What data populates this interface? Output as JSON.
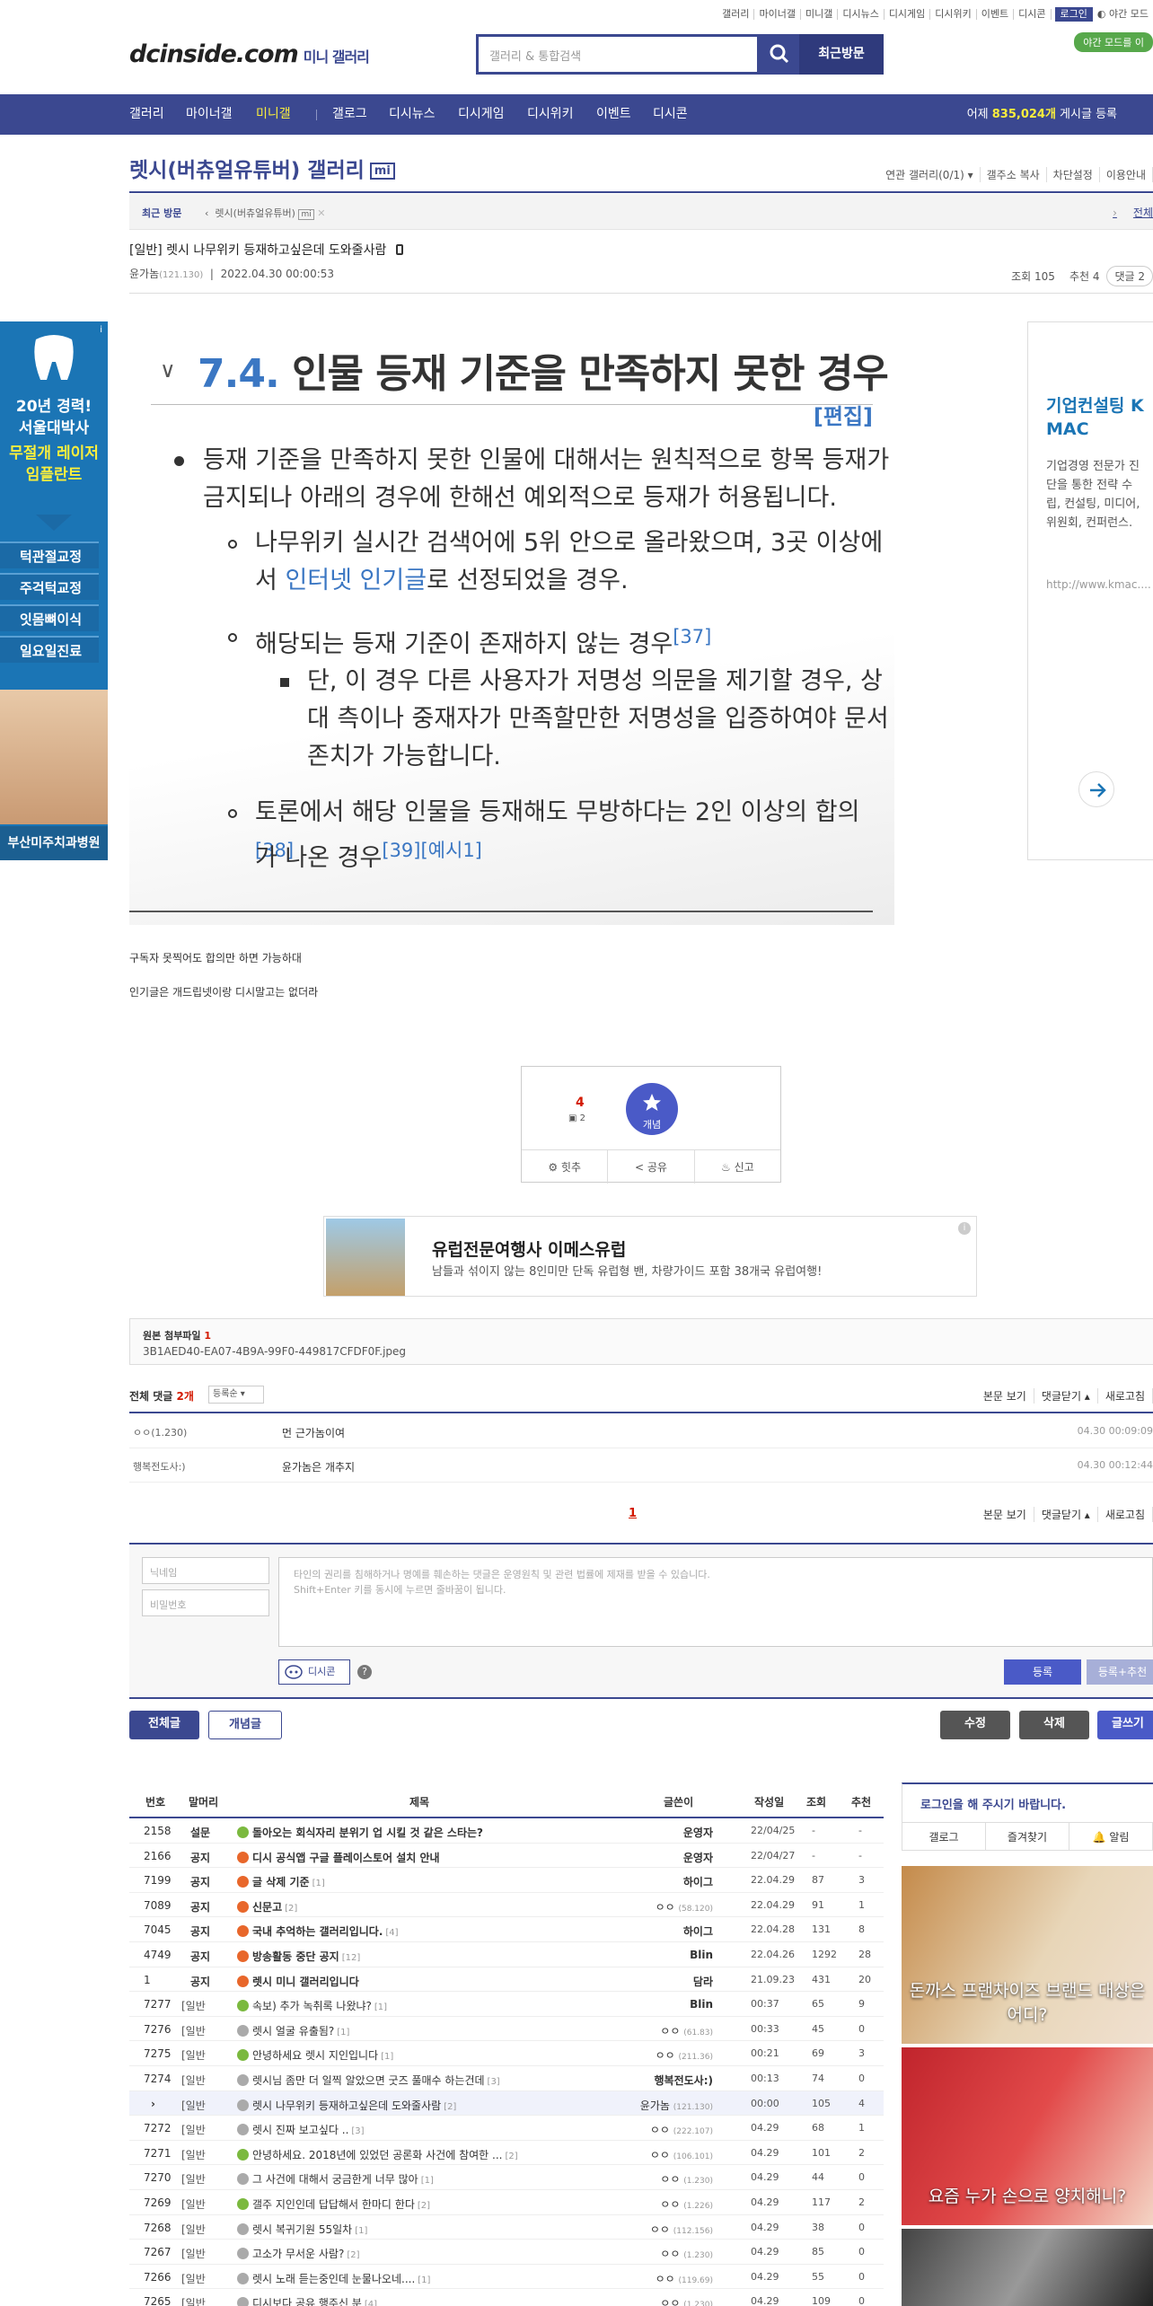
{
  "top_util": {
    "links": [
      "갤러리",
      "마이너갤",
      "미니갤",
      "디시뉴스",
      "디시게임",
      "디시위키",
      "이벤트",
      "디시콘"
    ],
    "login": "로그인",
    "night": "야간 모드",
    "night_badge": "야간 모드를 이"
  },
  "logo": {
    "brand": "dcinside.com",
    "sub": "미니 갤러리"
  },
  "search": {
    "placeholder": "갤러리 & 통합검색",
    "recent": "최근방문"
  },
  "nav": {
    "items": [
      "갤러리",
      "마이너갤",
      "미니갤",
      "갤로그",
      "디시뉴스",
      "디시게임",
      "디시위키",
      "이벤트",
      "디시콘"
    ],
    "visit_prefix": "어제 ",
    "visit_count": "835,024개",
    "visit_suffix": " 게시글 등록"
  },
  "gallery": {
    "title": "렛시(버츄얼유튜버) 갤러리",
    "badge": "mi",
    "menu": [
      "연관 갤러리(0/1) ▾",
      "갤주소 복사",
      "차단설정",
      "이용안내"
    ]
  },
  "recent_bar": {
    "label": "최근 방문",
    "item": "렛시(버츄얼유튜버)",
    "badge": "mi",
    "all": "전체"
  },
  "post": {
    "title": "[일반] 렛시 나무위키 등재하고싶은데 도와줄사람",
    "author": "윤가놈",
    "ip": "(121.130)",
    "date": "2022.04.30 00:00:53",
    "views": "조회 105",
    "recs": "추천 4",
    "comments": "댓글 2"
  },
  "wiki": {
    "num": "7.4.",
    "heading": "인물 등재 기준을 만족하지 못한 경우",
    "edit": "[편집]",
    "b1_l1": "등재 기준을 만족하지 못한 인물에 대해서는 원칙적으로 항목 등재가",
    "b1_l2": "금지되나 아래의 경우에 한해선 예외적으로 등재가 허용됩니다.",
    "b2_l1": "나무위키 실시간 검색어에 5위 안으로 올라왔으며, 3곳 이상에",
    "b2_pre": "서 ",
    "b2_link": "인터넷 인기글",
    "b2_post": "로 선정되었을 경우.",
    "b3": "해당되는 등재 기준이 존재하지 않는 경우",
    "b3_sup": "[37]",
    "b4_l1": "단, 이 경우 다른 사용자가 저명성 의문을 제기할 경우, 상",
    "b4_l2": "대 측이나 중재자가 만족할만한 저명성을 입증하여야 문서",
    "b4_l3": "존치가 가능합니다.",
    "b5_l1": "토론에서 해당 인물을 등재해도 무방하다는 2인 이상의 합의",
    "b5_sup1": "[38]",
    "b5_l2": "가 나온 경우",
    "b5_sup2": "[39]",
    "b5_sup3": "[예시1]"
  },
  "body": {
    "line1": "구독자 못찍어도 합의만 하면 가능하대",
    "line2": "인기글은 개드립넷이랑 디시말고는 없더라"
  },
  "recommend": {
    "count": "4",
    "sub": "2",
    "concept": "개념",
    "actions": [
      "힛추",
      "공유",
      "신고"
    ]
  },
  "banner": {
    "title": "유럽전문여행사 이메스유럽",
    "desc": "남들과 섞이지 않는 8인미만 단독 유럽형 밴, 차량가이드 포함 38개국 유럽여행!",
    "info": "i"
  },
  "attachment": {
    "label": "원본 첨부파일",
    "count": "1",
    "file": "3B1AED40-EA07-4B9A-99F0-449817CFDF0F.jpeg"
  },
  "comments": {
    "label": "전체 댓글",
    "count": "2개",
    "sort": "등록순 ▾",
    "options": [
      "본문 보기",
      "댓글닫기 ▴",
      "새로고침"
    ],
    "items": [
      {
        "nick": "ㅇㅇ(1.230)",
        "text": "먼 근가놈이여",
        "date": "04.30 00:09:09"
      },
      {
        "nick": "행복전도사:)",
        "text": "윤가놈은 개추지",
        "date": "04.30 00:12:44"
      }
    ],
    "page": "1"
  },
  "write": {
    "nick": "닉네임",
    "pw": "비밀번호",
    "ta1": "타인의 권리를 침해하거나 명예를 훼손하는 댓글은 운영원칙 및 관련 법률에 제재를 받을 수 있습니다.",
    "ta2": "Shift+Enter 키를 동시에 누르면 줄바꿈이 됩니다.",
    "dccon": "디시콘",
    "help": "?",
    "submit": "등록",
    "submit_rec": "등록+추천"
  },
  "buttons": {
    "all": "전체글",
    "concept": "개념글",
    "edit": "수정",
    "delete": "삭제",
    "write": "글쓰기"
  },
  "table": {
    "headers": [
      "번호",
      "말머리",
      "제목",
      "글쓴이",
      "작성일",
      "조회",
      "추천"
    ],
    "rows": [
      {
        "no": "2158",
        "head": "설문",
        "title": "돌아오는 회식자리 분위기 업 시킬 것 같은 스타는?",
        "cnt": "",
        "writer": "운영자",
        "ip": "",
        "date": "22/04/25",
        "view": "-",
        "rec": "-",
        "icon": "#7bb93f",
        "bold": true
      },
      {
        "no": "2166",
        "head": "공지",
        "title": "디시 공식앱 구글 플레이스토어 설치 안내",
        "cnt": "",
        "writer": "운영자",
        "ip": "",
        "date": "22/04/27",
        "view": "-",
        "rec": "-",
        "icon": "#e8672b",
        "bold": true
      },
      {
        "no": "7199",
        "head": "공지",
        "title": "글 삭제 기준",
        "cnt": "[1]",
        "writer": "하이그",
        "ip": "",
        "date": "22.04.29",
        "view": "87",
        "rec": "3",
        "icon": "#e8672b",
        "bold": true
      },
      {
        "no": "7089",
        "head": "공지",
        "title": "신문고",
        "cnt": "[2]",
        "writer": "ㅇㅇ",
        "ip": "(58.120)",
        "date": "22.04.29",
        "view": "91",
        "rec": "1",
        "icon": "#e8672b",
        "bold": true
      },
      {
        "no": "7045",
        "head": "공지",
        "title": "국내 추억하는 갤러리입니다.",
        "cnt": "[4]",
        "writer": "하이그",
        "ip": "",
        "date": "22.04.28",
        "view": "131",
        "rec": "8",
        "icon": "#e8672b",
        "bold": true
      },
      {
        "no": "4749",
        "head": "공지",
        "title": "방송활동 중단 공지",
        "cnt": "[12]",
        "writer": "Blin",
        "ip": "",
        "date": "22.04.26",
        "view": "1292",
        "rec": "28",
        "icon": "#e8672b",
        "bold": true
      },
      {
        "no": "1",
        "head": "공지",
        "title": "렛시 미니 갤러리입니다",
        "cnt": "",
        "writer": "담라",
        "ip": "",
        "date": "21.09.23",
        "view": "431",
        "rec": "20",
        "icon": "#e8672b",
        "bold": true
      },
      {
        "no": "7277",
        "head": "[일반",
        "title": "속보) 추가 녹취록 나왔냐?",
        "cnt": "[1]",
        "writer": "Blin",
        "ip": "",
        "date": "00:37",
        "view": "65",
        "rec": "9",
        "icon": "#7bb93f",
        "bold": false
      },
      {
        "no": "7276",
        "head": "[일반",
        "title": "렛시 얼굴 유출됨?",
        "cnt": "[1]",
        "writer": "ㅇㅇ",
        "ip": "(61.83)",
        "date": "00:33",
        "view": "45",
        "rec": "0",
        "icon": "#aaa",
        "bold": false
      },
      {
        "no": "7275",
        "head": "[일반",
        "title": "안녕하세요 렛시 지인입니다",
        "cnt": "[1]",
        "writer": "ㅇㅇ",
        "ip": "(211.36)",
        "date": "00:21",
        "view": "69",
        "rec": "3",
        "icon": "#7bb93f",
        "bold": false
      },
      {
        "no": "7274",
        "head": "[일반",
        "title": "렛시님 좀만 더 일찍 알았으면 굿즈 풀매수 하는건데",
        "cnt": "[3]",
        "writer": "행복전도사:)",
        "ip": "",
        "date": "00:13",
        "view": "74",
        "rec": "0",
        "icon": "#aaa",
        "bold": false
      },
      {
        "no": "›",
        "head": "[일반",
        "title": "렛시 나무위키 등재하고싶은데 도와줄사람",
        "cnt": "[2]",
        "writer": "윤가놈",
        "ip": "(121.130)",
        "date": "00:00",
        "view": "105",
        "rec": "4",
        "icon": "#aaa",
        "bold": false,
        "current": true
      },
      {
        "no": "7272",
        "head": "[일반",
        "title": "렛시 진짜 보고싶다 ..",
        "cnt": "[3]",
        "writer": "ㅇㅇ",
        "ip": "(222.107)",
        "date": "04.29",
        "view": "68",
        "rec": "1",
        "icon": "#aaa",
        "bold": false
      },
      {
        "no": "7271",
        "head": "[일반",
        "title": "안녕하세요. 2018년에 있었던 공론화 사건에 참여한 ...",
        "cnt": "[2]",
        "writer": "ㅇㅇ",
        "ip": "(106.101)",
        "date": "04.29",
        "view": "101",
        "rec": "2",
        "icon": "#7bb93f",
        "bold": false
      },
      {
        "no": "7270",
        "head": "[일반",
        "title": "그 사건에 대해서 궁금한게 너무 많아",
        "cnt": "[1]",
        "writer": "ㅇㅇ",
        "ip": "(1.230)",
        "date": "04.29",
        "view": "44",
        "rec": "0",
        "icon": "#aaa",
        "bold": false
      },
      {
        "no": "7269",
        "head": "[일반",
        "title": "갤주 지인인데 답답해서 한마디 한다",
        "cnt": "[2]",
        "writer": "ㅇㅇ",
        "ip": "(1.226)",
        "date": "04.29",
        "view": "117",
        "rec": "2",
        "icon": "#7bb93f",
        "bold": false
      },
      {
        "no": "7268",
        "head": "[일반",
        "title": "렛시 복귀기원 55일차",
        "cnt": "[1]",
        "writer": "ㅇㅇ",
        "ip": "(112.156)",
        "date": "04.29",
        "view": "38",
        "rec": "0",
        "icon": "#aaa",
        "bold": false
      },
      {
        "no": "7267",
        "head": "[일반",
        "title": "고소가 무서운 사람?",
        "cnt": "[2]",
        "writer": "ㅇㅇ",
        "ip": "(1.230)",
        "date": "04.29",
        "view": "85",
        "rec": "0",
        "icon": "#aaa",
        "bold": false
      },
      {
        "no": "7266",
        "head": "[일반",
        "title": "렛시 노래 듣는중인데 눈물나오네....",
        "cnt": "[1]",
        "writer": "ㅇㅇ",
        "ip": "(119.69)",
        "date": "04.29",
        "view": "55",
        "rec": "0",
        "icon": "#aaa",
        "bold": false
      },
      {
        "no": "7265",
        "head": "[일반",
        "title": "디시보다 공유 행주신 분",
        "cnt": "[4]",
        "writer": "ㅇㅇ",
        "ip": "(1.230)",
        "date": "04.29",
        "view": "109",
        "rec": "0",
        "icon": "#aaa",
        "bold": false
      }
    ]
  },
  "side": {
    "login_msg": "로그인을 해 주시기 바랍니다.",
    "menu": [
      "갤로그",
      "즐겨찾기",
      "알림"
    ],
    "ad1": "돈까스 프랜차이즈 브랜드 대상은 어디?",
    "ad2": "요즘 누가 손으로 양치해니?"
  },
  "left_ad": {
    "l1": "20년 경력!",
    "l2": "서울대박사",
    "l3": "무절개 레이저",
    "l4": "임플란트",
    "btns": [
      "턱관절교정",
      "주걱턱교정",
      "잇몸뼈이식",
      "일요일진료"
    ],
    "foot": "부산미주치과병원"
  },
  "right_ad": {
    "title1": "기업컨설팅 K",
    "title2": "MAC",
    "d1": "기업경영 전문가 진",
    "d2": "단을 통한 전략 수",
    "d3": "립, 컨설팅, 미디어,",
    "d4": "위원회, 컨퍼런스.",
    "url": "http://www.kmac...."
  }
}
